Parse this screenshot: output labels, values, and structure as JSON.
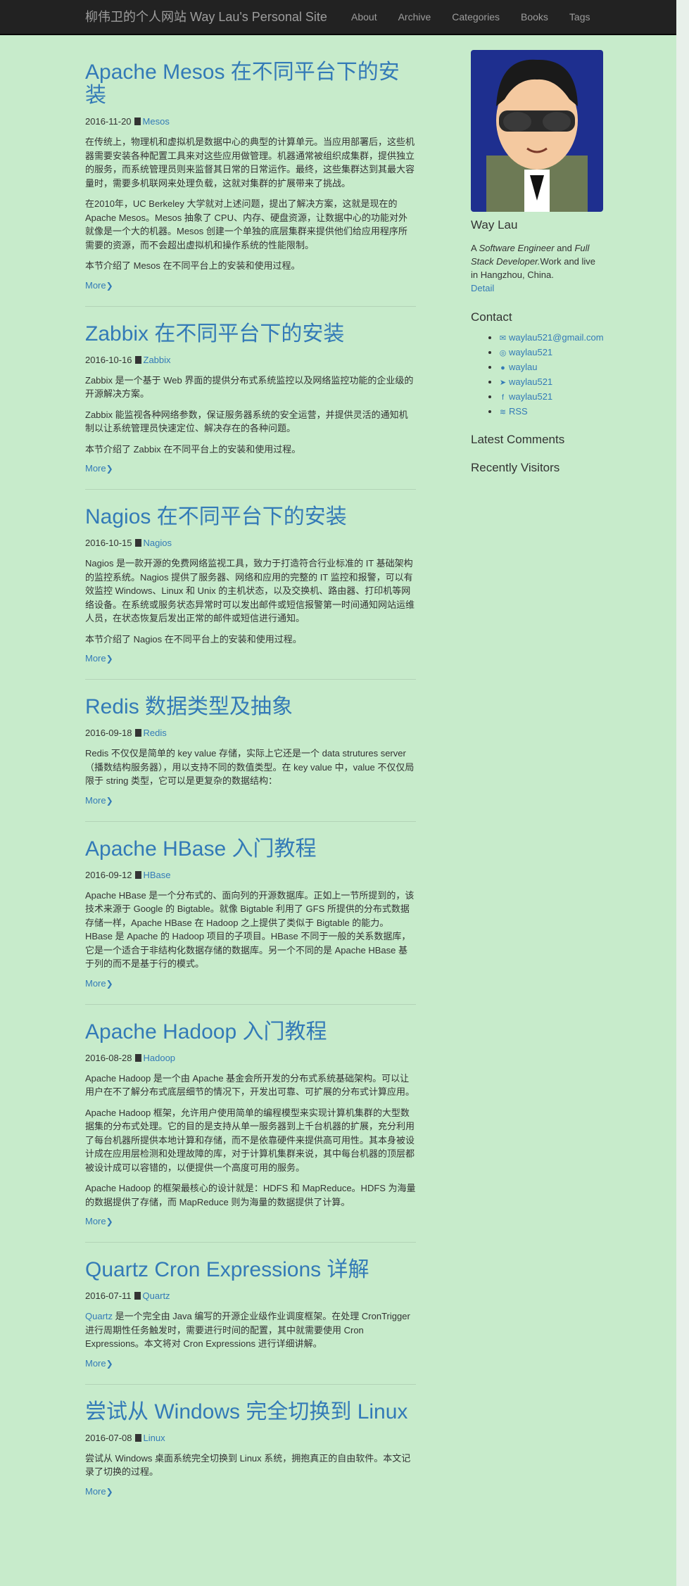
{
  "nav": {
    "brand": "柳伟卫的个人网站 Way Lau's Personal Site",
    "items": [
      "About",
      "Archive",
      "Categories",
      "Books",
      "Tags"
    ]
  },
  "posts": [
    {
      "title": "Apache Mesos 在不同平台下的安装",
      "date": "2016-11-20",
      "category": "Mesos",
      "paragraphs": [
        "在传统上，物理机和虚拟机是数据中心的典型的计算单元。当应用部署后，这些机器需要安装各种配置工具来对这些应用做管理。机器通常被组织成集群，提供独立的服务，而系统管理员则来监督其日常的日常运作。最终，这些集群达到其最大容量时，需要多机联网来处理负载，这就对集群的扩展带来了挑战。",
        "在2010年，UC Berkeley 大学就对上述问题，提出了解决方案，这就是现在的 Apache Mesos。Mesos 抽象了 CPU、内存、硬盘资源，让数据中心的功能对外就像是一个大的机器。Mesos 创建一个单独的底层集群来提供他们给应用程序所需要的资源，而不会超出虚拟机和操作系统的性能限制。",
        "本节介绍了 Mesos 在不同平台上的安装和使用过程。"
      ],
      "more": "More"
    },
    {
      "title": "Zabbix 在不同平台下的安装",
      "date": "2016-10-16",
      "category": "Zabbix",
      "paragraphs": [
        "Zabbix 是一个基于 Web 界面的提供分布式系统监控以及网络监控功能的企业级的开源解决方案。",
        "Zabbix 能监视各种网络参数，保证服务器系统的安全运营，并提供灵活的通知机制以让系统管理员快速定位、解决存在的各种问题。",
        "本节介绍了 Zabbix 在不同平台上的安装和使用过程。"
      ],
      "more": "More"
    },
    {
      "title": "Nagios 在不同平台下的安装",
      "date": "2016-10-15",
      "category": "Nagios",
      "paragraphs": [
        "Nagios 是一款开源的免费网络监视工具，致力于打造符合行业标准的 IT 基础架构的监控系统。Nagios 提供了服务器、网络和应用的完整的 IT 监控和报警，可以有效监控 Windows、Linux 和 Unix 的主机状态，以及交换机、路由器、打印机等网络设备。在系统或服务状态异常时可以发出邮件或短信报警第一时间通知网站运维人员，在状态恢复后发出正常的邮件或短信进行通知。",
        "本节介绍了 Nagios 在不同平台上的安装和使用过程。"
      ],
      "more": "More"
    },
    {
      "title": "Redis 数据类型及抽象",
      "date": "2016-09-18",
      "category": "Redis",
      "paragraphs": [
        "Redis 不仅仅是简单的 key value 存储，实际上它还是一个 data strutures server（播数结构服务器），用以支持不同的数值类型。在 key value 中，value 不仅仅局限于 string 类型，它可以是更复杂的数据结构："
      ],
      "more": "More"
    },
    {
      "title": "Apache HBase 入门教程",
      "date": "2016-09-12",
      "category": "HBase",
      "paragraphs": [
        "Apache HBase 是一个分布式的、面向列的开源数据库。正如上一节所提到的，该技术来源于 Google 的 Bigtable。就像 Bigtable 利用了 GFS 所提供的分布式数据存储一样，Apache HBase 在 Hadoop 之上提供了类似于 Bigtable 的能力。HBase 是 Apache 的 Hadoop 项目的子项目。HBase 不同于一般的关系数据库，它是一个适合于非结构化数据存储的数据库。另一个不同的是 Apache HBase 基于列的而不是基于行的模式。"
      ],
      "more": "More"
    },
    {
      "title": "Apache Hadoop 入门教程",
      "date": "2016-08-28",
      "category": "Hadoop",
      "paragraphs": [
        "Apache Hadoop 是一个由 Apache 基金会所开发的分布式系统基础架构。可以让用户在不了解分布式底层细节的情况下，开发出可靠、可扩展的分布式计算应用。",
        "Apache Hadoop 框架，允许用户使用简单的编程模型来实现计算机集群的大型数据集的分布式处理。它的目的是支持从单一服务器到上千台机器的扩展，充分利用了每台机器所提供本地计算和存储，而不是依靠硬件来提供高可用性。其本身被设计成在应用层检测和处理故障的库，对于计算机集群来说，其中每台机器的顶层都被设计成可以容错的，以便提供一个高度可用的服务。",
        "Apache Hadoop 的框架最核心的设计就是：HDFS 和 MapReduce。HDFS 为海量的数据提供了存储，而 MapReduce 则为海量的数据提供了计算。"
      ],
      "more": "More"
    },
    {
      "title": "Quartz Cron Expressions 详解",
      "date": "2016-07-11",
      "category": "Quartz",
      "link_word": "Quartz",
      "paragraphs": [
        " 是一个完全由 Java 编写的开源企业级作业调度框架。在处理 CronTrigger 进行周期性任务触发时，需要进行时间的配置，其中就需要使用 Cron Expressions。本文将对 Cron Expressions 进行详细讲解。"
      ],
      "more": "More"
    },
    {
      "title": "尝试从 Windows 完全切换到 Linux",
      "date": "2016-07-08",
      "category": "Linux",
      "paragraphs": [
        "尝试从 Windows 桌面系统完全切换到 Linux 系统，拥抱真正的自由软件。本文记录了切换的过程。"
      ],
      "more": "More"
    }
  ],
  "sidebar": {
    "name": "Way Lau",
    "bio": {
      "a": "A ",
      "role1": "Software Engineer",
      "and": " and ",
      "role2": "Full Stack Developer.",
      "rest": "Work and live in Hangzhou, China.",
      "detail": "Detail"
    },
    "contact_title": "Contact",
    "contacts": [
      {
        "icon": "envelope-icon",
        "glyph": "✉",
        "text": "waylau521@gmail.com"
      },
      {
        "icon": "weibo-icon",
        "glyph": "◎",
        "text": "waylau521"
      },
      {
        "icon": "github-icon",
        "glyph": "●",
        "text": "waylau"
      },
      {
        "icon": "twitter-icon",
        "glyph": "➤",
        "text": "waylau521"
      },
      {
        "icon": "facebook-icon",
        "glyph": "f",
        "text": "waylau521"
      },
      {
        "icon": "rss-icon",
        "glyph": "≋",
        "text": "RSS"
      }
    ],
    "latest_comments": "Latest Comments",
    "recent_visitors": "Recently Visitors"
  },
  "colors": {
    "background": "#c7ebcb",
    "navbar": "#222222",
    "link": "#337ab7",
    "text": "#333333"
  }
}
